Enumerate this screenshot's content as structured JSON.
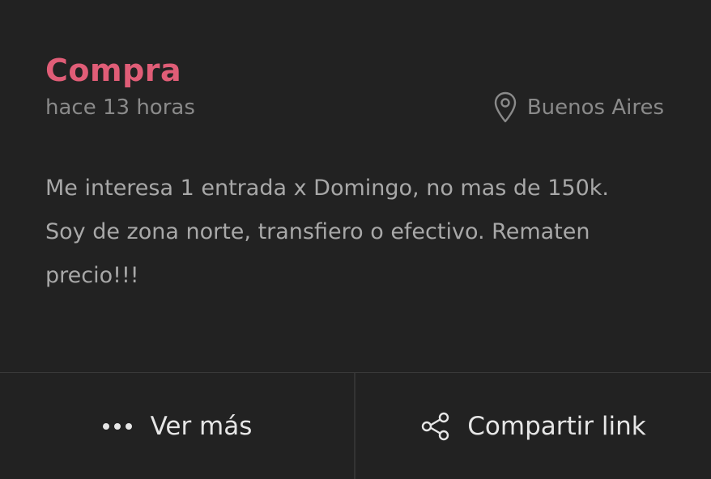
{
  "post": {
    "type": "Compra",
    "time_ago": "hace 13 horas",
    "location": "Buenos Aires",
    "description_lines": [
      "Me interesa 1 entrada x Domingo, no mas de 150k.",
      "Soy de zona norte, transfiero o efectivo. Rematen",
      "precio!!!"
    ]
  },
  "actions": {
    "more_label": "Ver más",
    "more_icon": "more-horizontal-icon",
    "share_label": "Compartir link",
    "share_icon": "share-icon"
  },
  "colors": {
    "background": "#222222",
    "accent": "#e05d77",
    "muted_text": "#8a8a8a",
    "body_text": "#a8a8a8",
    "action_text": "#e6e6e6"
  },
  "icons": {
    "location": "map-pin-icon"
  }
}
